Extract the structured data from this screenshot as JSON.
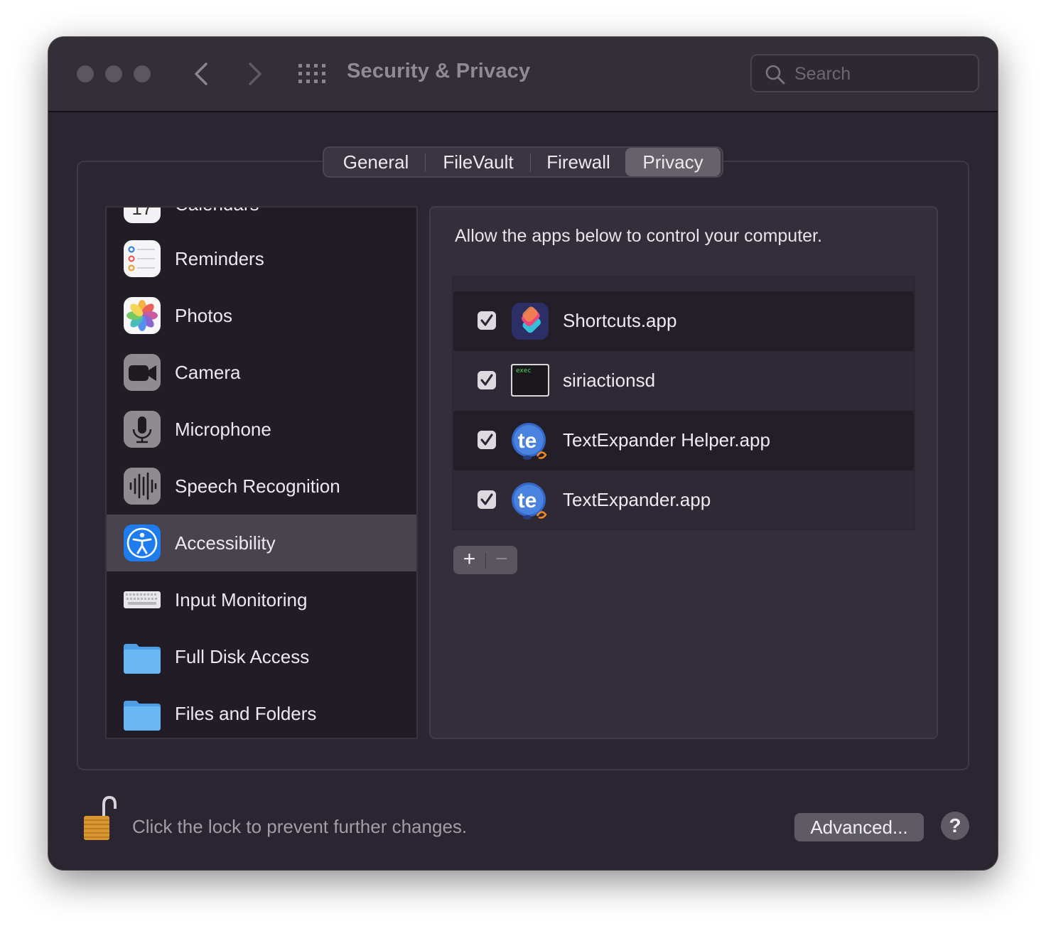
{
  "window": {
    "title": "Security & Privacy",
    "search_placeholder": "Search"
  },
  "tabs": [
    {
      "label": "General",
      "active": false
    },
    {
      "label": "FileVault",
      "active": false
    },
    {
      "label": "Firewall",
      "active": false
    },
    {
      "label": "Privacy",
      "active": true
    }
  ],
  "sidebar": {
    "items": [
      {
        "label": "Calendars",
        "icon": "calendar-icon",
        "selected": false
      },
      {
        "label": "Reminders",
        "icon": "reminders-icon",
        "selected": false
      },
      {
        "label": "Photos",
        "icon": "photos-icon",
        "selected": false
      },
      {
        "label": "Camera",
        "icon": "camera-icon",
        "selected": false
      },
      {
        "label": "Microphone",
        "icon": "microphone-icon",
        "selected": false
      },
      {
        "label": "Speech Recognition",
        "icon": "speech-recognition-icon",
        "selected": false
      },
      {
        "label": "Accessibility",
        "icon": "accessibility-icon",
        "selected": true
      },
      {
        "label": "Input Monitoring",
        "icon": "keyboard-icon",
        "selected": false
      },
      {
        "label": "Full Disk Access",
        "icon": "folder-icon",
        "selected": false
      },
      {
        "label": "Files and Folders",
        "icon": "folder-icon",
        "selected": false
      }
    ]
  },
  "panel": {
    "description": "Allow the apps below to control your computer.",
    "apps": [
      {
        "name": "Shortcuts.app",
        "checked": true,
        "icon": "shortcuts-icon"
      },
      {
        "name": "siriactionsd",
        "checked": true,
        "icon": "terminal-exec-icon",
        "icon_text": "exec"
      },
      {
        "name": "TextExpander Helper.app",
        "checked": true,
        "icon": "textexpander-icon",
        "icon_text": "te"
      },
      {
        "name": "TextExpander.app",
        "checked": true,
        "icon": "textexpander-icon",
        "icon_text": "te"
      }
    ],
    "add_label": "+",
    "remove_label": "−"
  },
  "footer": {
    "lock_text": "Click the lock to prevent further changes.",
    "advanced_label": "Advanced...",
    "help_label": "?"
  },
  "colors": {
    "window_bg": "#2a2530",
    "selected_row": "#48444d",
    "accessibility_blue": "#1f7cf0",
    "folder_blue": "#69b7f4"
  }
}
